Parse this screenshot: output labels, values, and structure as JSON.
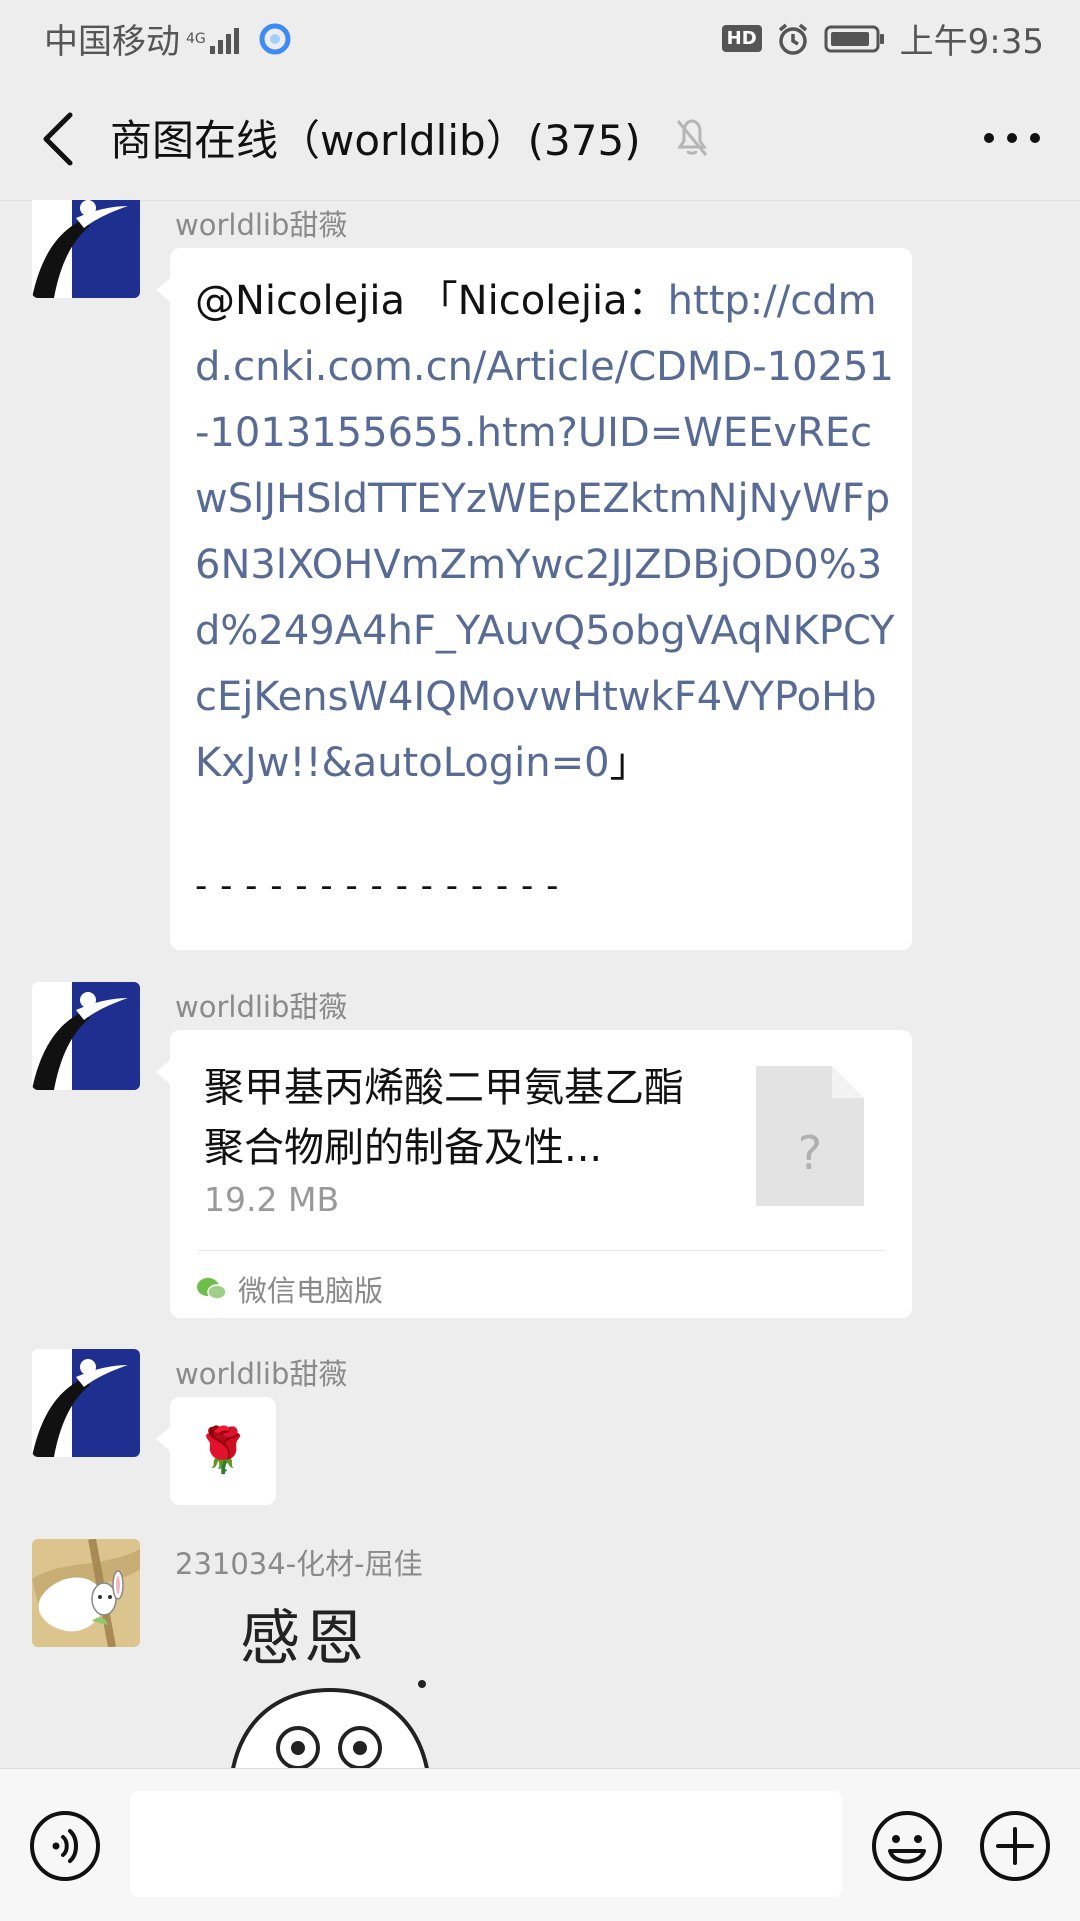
{
  "status_bar": {
    "carrier": "中国移动",
    "network": "4G",
    "hd_badge": "HD",
    "time": "上午9:35"
  },
  "nav": {
    "title": "商图在线（worldlib）(375)",
    "back_icon": "chevron-left-icon",
    "mute_icon": "bell-off-icon",
    "more_icon": "more-dots-icon"
  },
  "messages": [
    {
      "sender": "worldlib甜薇",
      "mention": "@Nicolejia",
      "quote_open": " 「Nicolejia：",
      "link": "http://cdmd.cnki.com.cn/Article/CDMD-10251-1013155655.htm?UID=WEEvREcwSlJHSldTTEYzWEpEZktmNjNyWFp6N3lXOHVmZmYwc2JJZDBjOD0%3d%249A4hF_YAuvQ5obgVAqNKPCYcEjKensW4IQMovwHtwkF4VYPoHbKxJw!!&autoLogin=0",
      "quote_close": "」",
      "divider": "- - - - - - - - - - - - - - -"
    },
    {
      "sender": "worldlib甜薇",
      "file_title": "聚甲基丙烯酸二甲氨基乙酯聚合物刷的制备及性...",
      "file_size": "19.2 MB",
      "file_icon_glyph": "?",
      "source": "微信电脑版"
    },
    {
      "sender": "worldlib甜薇",
      "emoji": "🌹"
    },
    {
      "sender": "231034-化材-屈佳",
      "sticker_text": "感恩"
    }
  ],
  "input": {
    "placeholder": "",
    "voice_icon": "voice-icon",
    "emoji_icon": "emoji-icon",
    "plus_icon": "plus-icon"
  },
  "colors": {
    "background": "#ededed",
    "bubble": "#ffffff",
    "link": "#576b95",
    "avatar_blue": "#1f2f8f",
    "sender_gray": "#8a8a8a"
  }
}
